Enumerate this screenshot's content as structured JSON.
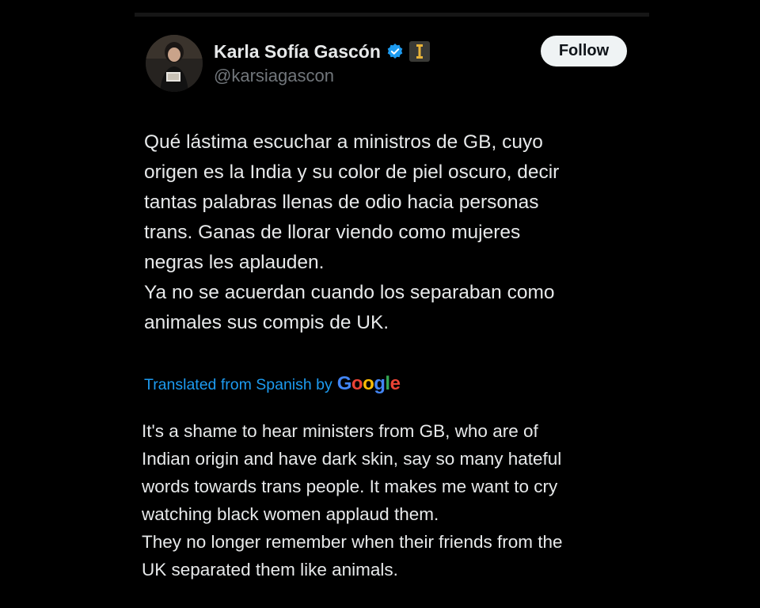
{
  "author": {
    "display_name": "Karla Sofía Gascón",
    "handle": "@karsiagascon",
    "avatar_icon": "profile-photo",
    "verified_icon": "verified-badge-icon",
    "affiliate_icon": "affiliate-badge-icon"
  },
  "follow_label": "Follow",
  "tweet": {
    "lines": [
      "Qué lástima escuchar a ministros de GB, cuyo",
      "origen es la India y su color de piel oscuro, decir",
      "tantas palabras llenas de odio hacia personas",
      "trans. Ganas de llorar viendo como mujeres",
      "negras les aplauden.",
      "Ya no se acuerdan cuando los separaban como",
      "animales sus compis de UK."
    ]
  },
  "translation": {
    "label": "Translated from Spanish by",
    "provider_letters": [
      "G",
      "o",
      "o",
      "g",
      "l",
      "e"
    ],
    "provider_colors": [
      "#4285f4",
      "#ea4335",
      "#fbbc05",
      "#4285f4",
      "#34a853",
      "#ea4335"
    ],
    "lines": [
      "It's a shame to hear ministers from GB, who are of",
      "Indian origin and have dark skin, say so many hateful",
      "words towards trans people. It makes me want to cry",
      "watching black women applaud them.",
      "They no longer remember when their friends from the",
      "UK separated them like animals."
    ]
  },
  "colors": {
    "background": "#000000",
    "text_primary": "#e7e9ea",
    "text_secondary": "#71767b",
    "link_blue": "#1d9bf0",
    "verified_blue": "#1d9bf0",
    "affiliate_gold": "#e8b339"
  }
}
